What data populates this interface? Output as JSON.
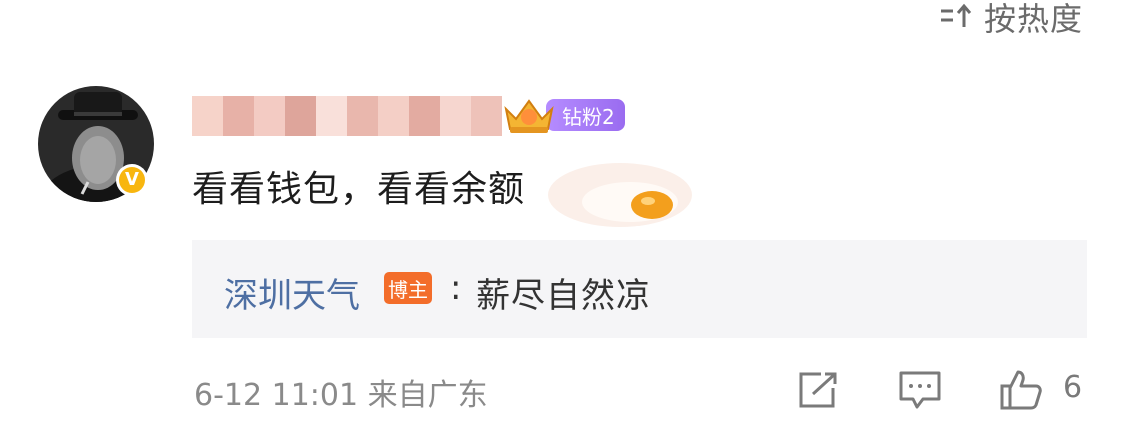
{
  "sort": {
    "label": "按热度"
  },
  "comment": {
    "fan_badge": "钻粉2",
    "text": "看看钱包，看看余额",
    "verified_badge": "V",
    "time": "6-12 11:01",
    "location": "来自广东",
    "likes": "6"
  },
  "reply": {
    "author": "深圳天气",
    "role_tag": "博主",
    "colon": ":",
    "text": "薪尽自然凉"
  },
  "icons": {
    "sort": "sort-icon",
    "share": "share-icon",
    "comment": "comment-icon",
    "like": "thumbs-up-icon",
    "egg": "fried-egg-icon",
    "crown": "crown-icon"
  },
  "colors": {
    "reply_author": "#4e6fa3",
    "role_tag": "#f36d2a",
    "fan_badge": "#a97cf8",
    "verified": "#f8b60f",
    "reply_bg": "#f5f5f7"
  }
}
